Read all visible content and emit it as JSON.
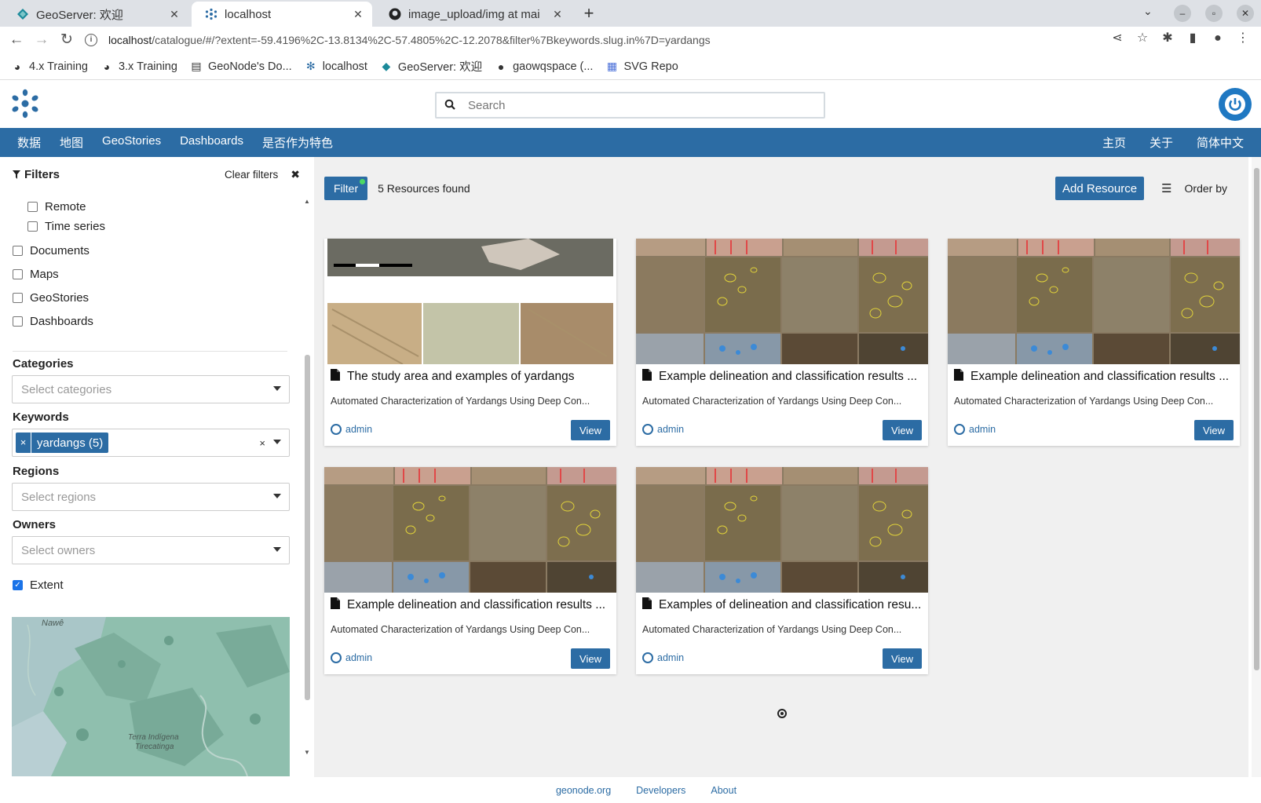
{
  "browser": {
    "tabs": [
      {
        "title": "GeoServer: 欢迎",
        "active": false
      },
      {
        "title": "localhost",
        "active": true
      },
      {
        "title": "image_upload/img at mai",
        "active": false
      }
    ],
    "url_host": "localhost",
    "url_path": "/catalogue/#/?extent=-59.4196%2C-13.8134%2C-57.4805%2C-12.2078&filter%7Bkeywords.slug.in%7D=yardangs",
    "bookmarks": [
      "4.x Training",
      "3.x Training",
      "GeoNode's Do...",
      "localhost",
      "GeoServer: 欢迎",
      "gaowqspace (...",
      "SVG Repo"
    ]
  },
  "header": {
    "search_placeholder": "Search"
  },
  "nav": {
    "left": [
      "数据",
      "地图",
      "GeoStories",
      "Dashboards",
      "是否作为特色"
    ],
    "right": [
      "主页",
      "关于",
      "简体中文"
    ]
  },
  "sidebar": {
    "title": "Filters",
    "clear_filters": "Clear filters",
    "types": [
      {
        "label": "Remote",
        "checked": false
      },
      {
        "label": "Time series",
        "checked": false
      },
      {
        "label": "Documents",
        "checked": false
      },
      {
        "label": "Maps",
        "checked": false
      },
      {
        "label": "GeoStories",
        "checked": false
      },
      {
        "label": "Dashboards",
        "checked": false
      }
    ],
    "categories_label": "Categories",
    "categories_placeholder": "Select categories",
    "keywords_label": "Keywords",
    "keyword_tag": "yardangs (5)",
    "regions_label": "Regions",
    "regions_placeholder": "Select regions",
    "owners_label": "Owners",
    "owners_placeholder": "Select owners",
    "extent_label": "Extent",
    "extent_checked": true,
    "map_labels": [
      "Nawê",
      "Terra Indígena",
      "Tirecatinga"
    ]
  },
  "toolbar": {
    "filter": "Filter",
    "found": "5 Resources found",
    "add": "Add Resource",
    "order": "Order by"
  },
  "cards": [
    {
      "title": "The study area and examples of yardangs",
      "desc": "Automated Characterization of Yardangs Using Deep Con...",
      "owner": "admin",
      "view": "View"
    },
    {
      "title": "Example delineation and classification results ...",
      "desc": "Automated Characterization of Yardangs Using Deep Con...",
      "owner": "admin",
      "view": "View"
    },
    {
      "title": "Example delineation and classification results ...",
      "desc": "Automated Characterization of Yardangs Using Deep Con...",
      "owner": "admin",
      "view": "View"
    },
    {
      "title": "Example delineation and classification results ...",
      "desc": "Automated Characterization of Yardangs Using Deep Con...",
      "owner": "admin",
      "view": "View"
    },
    {
      "title": "Examples of delineation and classification resu...",
      "desc": "Automated Characterization of Yardangs Using Deep Con...",
      "owner": "admin",
      "view": "View"
    }
  ],
  "footer": [
    "geonode.org",
    "Developers",
    "About"
  ],
  "colors": {
    "primary": "#2c6ca4",
    "nav": "#2c6ca4",
    "content_bg": "#f0f0f0"
  }
}
